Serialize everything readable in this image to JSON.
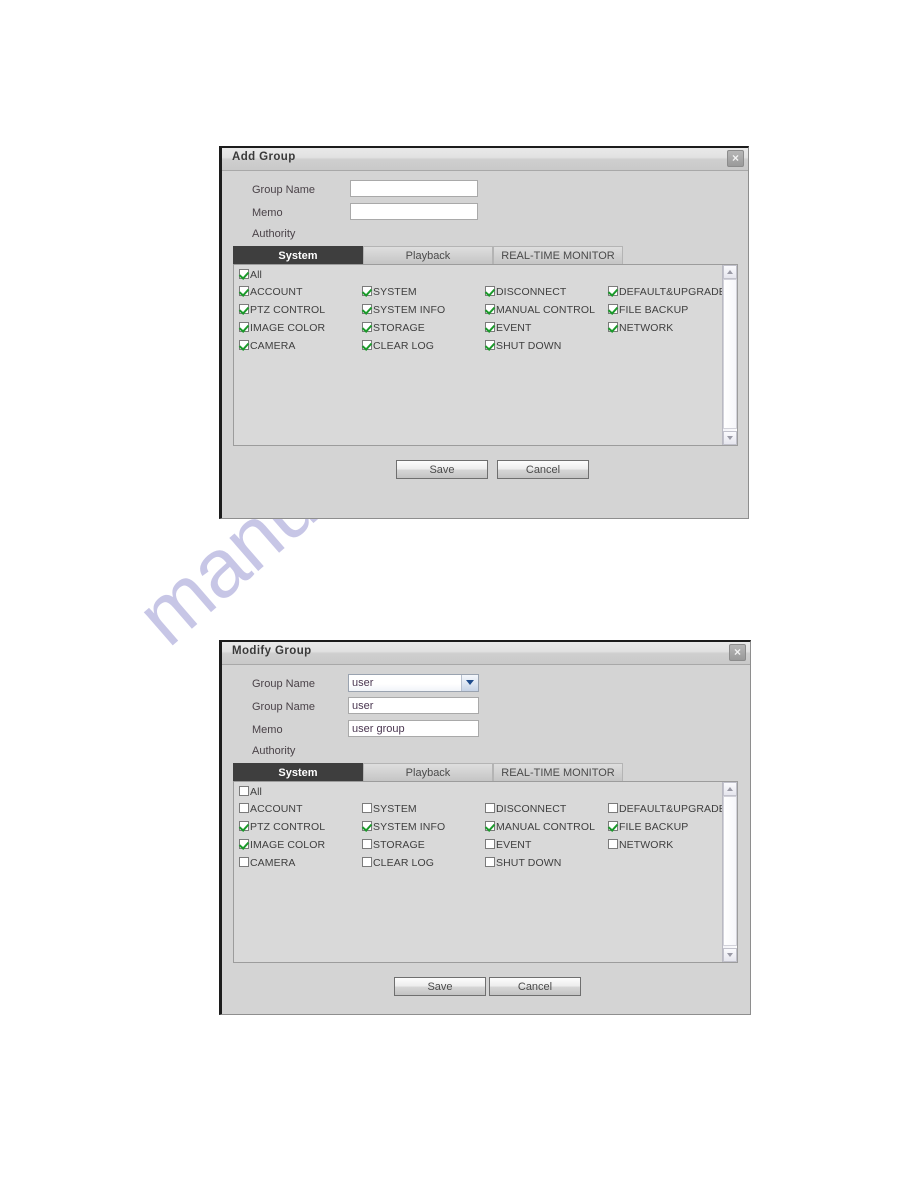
{
  "watermark": {
    "text": "manualshive.com"
  },
  "dialogs": [
    {
      "id": "add-group",
      "title": "Add Group",
      "close_label": "×",
      "fields": [
        {
          "label": "Group Name",
          "type": "text",
          "value": ""
        },
        {
          "label": "Memo",
          "type": "text",
          "value": ""
        }
      ],
      "authority_label": "Authority",
      "tabs": [
        {
          "label": "System",
          "active": true
        },
        {
          "label": "Playback",
          "active": false
        },
        {
          "label": "REAL-TIME MONITOR",
          "active": false
        }
      ],
      "all_checkbox": {
        "label": "All",
        "checked": true
      },
      "permissions": [
        {
          "label": "ACCOUNT",
          "checked": true,
          "col": 0,
          "row": 0
        },
        {
          "label": "PTZ CONTROL",
          "checked": true,
          "col": 0,
          "row": 1
        },
        {
          "label": "IMAGE COLOR",
          "checked": true,
          "col": 0,
          "row": 2
        },
        {
          "label": "CAMERA",
          "checked": true,
          "col": 0,
          "row": 3
        },
        {
          "label": "SYSTEM",
          "checked": true,
          "col": 1,
          "row": 0
        },
        {
          "label": "SYSTEM INFO",
          "checked": true,
          "col": 1,
          "row": 1
        },
        {
          "label": "STORAGE",
          "checked": true,
          "col": 1,
          "row": 2
        },
        {
          "label": "CLEAR LOG",
          "checked": true,
          "col": 1,
          "row": 3
        },
        {
          "label": "DISCONNECT",
          "checked": true,
          "col": 2,
          "row": 0
        },
        {
          "label": "MANUAL CONTROL",
          "checked": true,
          "col": 2,
          "row": 1
        },
        {
          "label": "EVENT",
          "checked": true,
          "col": 2,
          "row": 2
        },
        {
          "label": "SHUT DOWN",
          "checked": true,
          "col": 2,
          "row": 3
        },
        {
          "label": "DEFAULT&UPGRADE",
          "checked": true,
          "col": 3,
          "row": 0
        },
        {
          "label": "FILE BACKUP",
          "checked": true,
          "col": 3,
          "row": 1
        },
        {
          "label": "NETWORK",
          "checked": true,
          "col": 3,
          "row": 2
        }
      ],
      "buttons": {
        "save": "Save",
        "cancel": "Cancel"
      }
    },
    {
      "id": "modify-group",
      "title": "Modify Group",
      "close_label": "×",
      "fields": [
        {
          "label": "Group Name",
          "type": "select",
          "value": "user"
        },
        {
          "label": "Group Name",
          "type": "text",
          "value": "user"
        },
        {
          "label": "Memo",
          "type": "text",
          "value": "user group"
        }
      ],
      "authority_label": "Authority",
      "tabs": [
        {
          "label": "System",
          "active": true
        },
        {
          "label": "Playback",
          "active": false
        },
        {
          "label": "REAL-TIME MONITOR",
          "active": false
        }
      ],
      "all_checkbox": {
        "label": "All",
        "checked": false
      },
      "permissions": [
        {
          "label": "ACCOUNT",
          "checked": false,
          "col": 0,
          "row": 0
        },
        {
          "label": "PTZ CONTROL",
          "checked": true,
          "col": 0,
          "row": 1
        },
        {
          "label": "IMAGE COLOR",
          "checked": true,
          "col": 0,
          "row": 2
        },
        {
          "label": "CAMERA",
          "checked": false,
          "col": 0,
          "row": 3
        },
        {
          "label": "SYSTEM",
          "checked": false,
          "col": 1,
          "row": 0
        },
        {
          "label": "SYSTEM INFO",
          "checked": true,
          "col": 1,
          "row": 1
        },
        {
          "label": "STORAGE",
          "checked": false,
          "col": 1,
          "row": 2
        },
        {
          "label": "CLEAR LOG",
          "checked": false,
          "col": 1,
          "row": 3
        },
        {
          "label": "DISCONNECT",
          "checked": false,
          "col": 2,
          "row": 0
        },
        {
          "label": "MANUAL CONTROL",
          "checked": true,
          "col": 2,
          "row": 1
        },
        {
          "label": "EVENT",
          "checked": false,
          "col": 2,
          "row": 2
        },
        {
          "label": "SHUT DOWN",
          "checked": false,
          "col": 2,
          "row": 3
        },
        {
          "label": "DEFAULT&UPGRADE",
          "checked": false,
          "col": 3,
          "row": 0
        },
        {
          "label": "FILE BACKUP",
          "checked": true,
          "col": 3,
          "row": 1
        },
        {
          "label": "NETWORK",
          "checked": false,
          "col": 3,
          "row": 2
        }
      ],
      "buttons": {
        "save": "Save",
        "cancel": "Cancel"
      }
    }
  ]
}
